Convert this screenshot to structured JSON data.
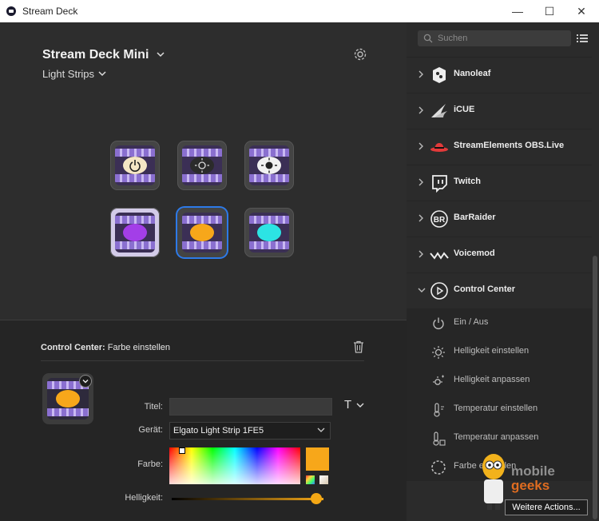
{
  "window": {
    "title": "Stream Deck",
    "minimize": "—",
    "maximize": "☐",
    "close": "✕"
  },
  "device": {
    "name": "Stream Deck Mini",
    "profile": "Light Strips"
  },
  "keys": [
    {
      "name": "power",
      "blob": "#f4e6c4"
    },
    {
      "name": "brightness-down",
      "blob": "#2b2b2b"
    },
    {
      "name": "brightness-up",
      "blob": "#f1f1f1"
    },
    {
      "name": "color-purple",
      "blob": "#a33ee8"
    },
    {
      "name": "color-orange",
      "blob": "#f7a71a"
    },
    {
      "name": "color-cyan",
      "blob": "#2ce4e4"
    }
  ],
  "props": {
    "plugin": "Control Center:",
    "action": "Farbe einstellen",
    "title_label": "Titel:",
    "title_value": "",
    "t_button": "T",
    "device_label": "Gerät:",
    "device_value": "Elgato Light Strip 1FE5",
    "color_label": "Farbe:",
    "color_value": "#f7a71a",
    "brightness_label": "Helligkeit:",
    "brightness_level": 0.95
  },
  "sidebar": {
    "search_placeholder": "Suchen",
    "categories": [
      {
        "label": "Nanoleaf"
      },
      {
        "label": "iCUE"
      },
      {
        "label": "StreamElements OBS.Live"
      },
      {
        "label": "Twitch"
      },
      {
        "label": "BarRaider"
      },
      {
        "label": "Voicemod"
      },
      {
        "label": "Control Center"
      }
    ],
    "actions": [
      {
        "label": "Ein / Aus"
      },
      {
        "label": "Helligkeit einstellen"
      },
      {
        "label": "Helligkeit anpassen"
      },
      {
        "label": "Temperatur einstellen"
      },
      {
        "label": "Temperatur anpassen"
      },
      {
        "label": "Farbe einstellen"
      }
    ],
    "more_button": "Weitere Actions..."
  },
  "watermark": {
    "line1": "mobile",
    "line2": "geeks"
  }
}
